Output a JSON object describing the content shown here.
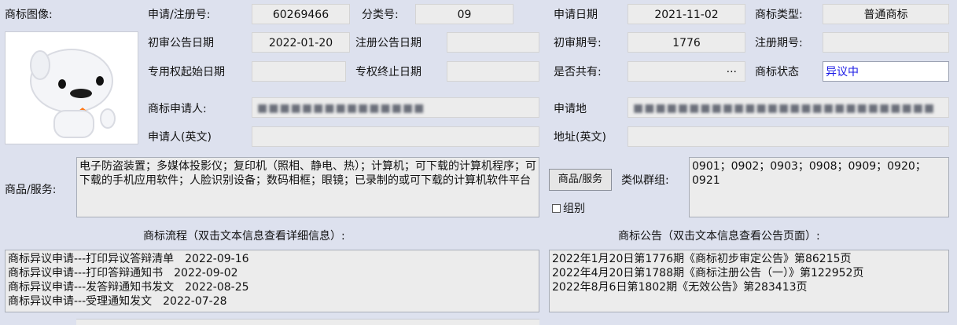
{
  "image_label": "商标图像:",
  "row1": {
    "reg_no_label": "申请/注册号:",
    "reg_no": "60269466",
    "class_label": "分类号:",
    "class_no": "09",
    "apply_date_label": "申请日期",
    "apply_date": "2021-11-02",
    "tm_type_label": "商标类型:",
    "tm_type": "普通商标"
  },
  "row2": {
    "prelim_date_label": "初审公告日期",
    "prelim_date": "2022-01-20",
    "reg_pub_date_label": "注册公告日期",
    "reg_pub_date": "",
    "prelim_issue_label": "初审期号:",
    "prelim_issue": "1776",
    "reg_issue_label": "注册期号:",
    "reg_issue": ""
  },
  "row3": {
    "right_start_label": "专用权起始日期",
    "right_start": "",
    "right_end_label": "专权终止日期",
    "right_end": "",
    "shared_label": "是否共有:",
    "shared_value": "···",
    "status_label": "商标状态",
    "status": "异议中"
  },
  "applicant": {
    "label": "商标申请人:",
    "value": "■■■■■■■■■■■■■■■",
    "addr_label": "申请地",
    "addr": "■■■■■■■■■■■■■■■■■■■■■■■■■■■"
  },
  "applicant_en": {
    "label": "申请人(英文)",
    "value": "",
    "addr_label": "地址(英文)",
    "addr": ""
  },
  "goods": {
    "label": "商品/服务:",
    "text": "电子防盗装置；多媒体投影仪；复印机（照相、静电、热）；计算机；可下载的计算机程序；可下载的手机应用软件；人脸识别设备；数码相框；眼镜；已录制的或可下载的计算机软件平台",
    "button": "商品/服务",
    "similar_label": "类似群组:",
    "similar": "0901；0902；0903；0908；0909；0920；0921",
    "group_check": "组别"
  },
  "flow": {
    "title": "商标流程（双击文本信息查看详细信息）:",
    "items": [
      "商标异议申请---打印异议答辩清单　2022-09-16",
      "商标异议申请---打印答辩通知书　2022-09-02",
      "商标异议申请---发答辩通知书发文　2022-08-25",
      "商标异议申请---受理通知发文　2022-07-28"
    ]
  },
  "notice": {
    "title": "商标公告（双击文本信息查看公告页面）:",
    "items": [
      "2022年1月20日第1776期《商标初步审定公告》第86215页",
      "2022年4月20日第1788期《商标注册公告（一）》第122952页",
      "2022年8月6日第1802期《无效公告》第283413页"
    ]
  }
}
